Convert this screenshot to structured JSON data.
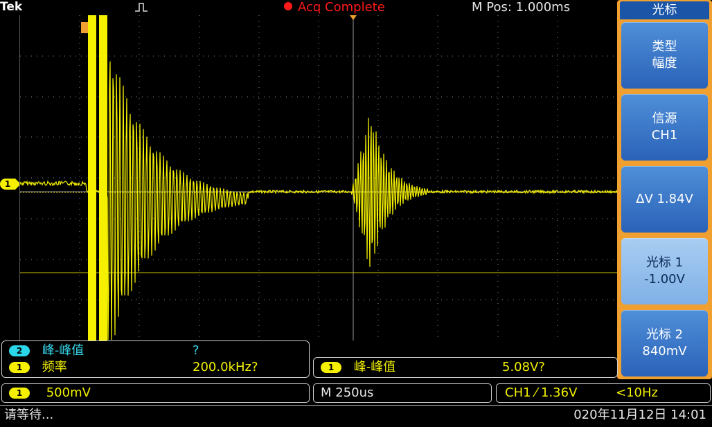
{
  "header": {
    "brand": "Tek",
    "acq_status": "Acq Complete",
    "m_pos": "M Pos: 1.000ms"
  },
  "channel_marker": "1",
  "side_menu": {
    "title": "光标",
    "buttons": [
      {
        "line1": "类型",
        "line2": "幅度"
      },
      {
        "line1": "信源",
        "line2": "CH1"
      },
      {
        "line1": "ΔV 1.84V",
        "line2": ""
      },
      {
        "line1": "光标 1",
        "line2": "-1.00V"
      },
      {
        "line1": "光标 2",
        "line2": "840mV"
      }
    ]
  },
  "measurements": {
    "box1": {
      "row1": {
        "badge": "2",
        "label": "峰-峰值",
        "value": "?"
      },
      "row2": {
        "badge": "1",
        "label": "频率",
        "value": "200.0kHz?"
      }
    },
    "box2": {
      "row1": {
        "badge": "1",
        "label": "峰-峰值",
        "value": "5.08V?"
      }
    }
  },
  "status": {
    "ch1_badge": "1",
    "ch1_scale": "500mV",
    "timebase": "M 250us",
    "trigger": "CH1 ⁄ 1.36V",
    "trigger_freq": "<10Hz"
  },
  "footer": {
    "message": "请等待...",
    "datetime": "020年11月12日 14:01"
  },
  "colors": {
    "trace": "#f4f000",
    "accent_orange": "#f0a030",
    "menu_blue": "#2a62b8",
    "acq_red": "#ff1a1a"
  }
}
